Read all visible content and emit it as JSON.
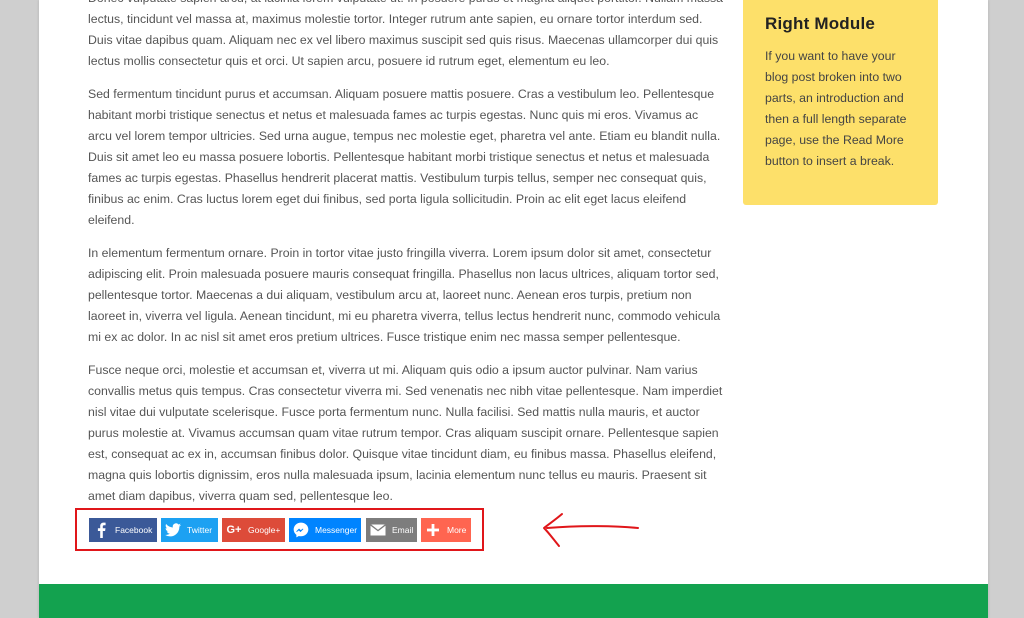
{
  "content": {
    "paragraphs": [
      "Donec vulputate sapien arcu, at lacinia lorem vulputate ut. In posuere purus et magna aliquet porttitor. Nullam massa lectus, tincidunt vel massa at, maximus molestie tortor. Integer rutrum ante sapien, eu ornare tortor interdum sed. Duis vitae dapibus quam. Aliquam nec ex vel libero maximus suscipit sed quis risus. Maecenas ullamcorper dui quis lectus mollis consectetur quis et orci. Ut sapien arcu, posuere id rutrum eget, elementum eu leo.",
      "Sed fermentum tincidunt purus et accumsan. Aliquam posuere mattis posuere. Cras a vestibulum leo. Pellentesque habitant morbi tristique senectus et netus et malesuada fames ac turpis egestas. Nunc quis mi eros. Vivamus ac arcu vel lorem tempor ultricies. Sed urna augue, tempus nec molestie eget, pharetra vel ante. Etiam eu blandit nulla. Duis sit amet leo eu massa posuere lobortis. Pellentesque habitant morbi tristique senectus et netus et malesuada fames ac turpis egestas. Phasellus hendrerit placerat mattis. Vestibulum turpis tellus, semper nec consequat quis, finibus ac enim. Cras luctus lorem eget dui finibus, sed porta ligula sollicitudin. Proin ac elit eget lacus eleifend eleifend.",
      "In elementum fermentum ornare. Proin in tortor vitae justo fringilla viverra. Lorem ipsum dolor sit amet, consectetur adipiscing elit. Proin malesuada posuere mauris consequat fringilla. Phasellus non lacus ultrices, aliquam tortor sed, pellentesque tortor. Maecenas a dui aliquam, vestibulum arcu at, laoreet nunc. Aenean eros turpis, pretium non laoreet in, viverra vel ligula. Aenean tincidunt, mi eu pharetra viverra, tellus lectus hendrerit nunc, commodo vehicula mi ex ac dolor. In ac nisl sit amet eros pretium ultrices. Fusce tristique enim nec massa semper pellentesque.",
      "Fusce neque orci, molestie et accumsan et, viverra ut mi. Aliquam quis odio a ipsum auctor pulvinar. Nam varius convallis metus quis tempus. Cras consectetur viverra mi. Sed venenatis nec nibh vitae pellentesque. Nam imperdiet nisl vitae dui vulputate scelerisque. Fusce porta fermentum nunc. Nulla facilisi. Sed mattis nulla mauris, et auctor purus molestie at. Vivamus accumsan quam vitae rutrum tempor. Cras aliquam suscipit ornare. Pellentesque sapien est, consequat ac ex in, accumsan finibus dolor. Quisque vitae tincidunt diam, eu finibus massa. Phasellus eleifend, magna quis lobortis dignissim, eros nulla malesuada ipsum, lacinia elementum nunc tellus eu mauris. Praesent sit amet diam dapibus, viverra quam sed, pellentesque leo."
    ]
  },
  "right_module": {
    "title": "Right Module",
    "text": "If you want to have your blog post broken into two parts, an introduction and then a full length separate page, use the Read More button to insert a break.",
    "background": "#fde06a"
  },
  "share": {
    "buttons": [
      {
        "label": "Facebook",
        "icon": "facebook-icon",
        "color": "#3b5998"
      },
      {
        "label": "Twitter",
        "icon": "twitter-icon",
        "color": "#1da1f2"
      },
      {
        "label": "Google+",
        "icon": "google-plus-icon",
        "color": "#dd4b39"
      },
      {
        "label": "Messenger",
        "icon": "messenger-icon",
        "color": "#0084ff"
      },
      {
        "label": "Email",
        "icon": "email-icon",
        "color": "#7d7d7d"
      },
      {
        "label": "More",
        "icon": "plus-icon",
        "color": "#ff6550"
      }
    ],
    "highlight_color": "#e0161a"
  },
  "footer": {
    "color": "#13a24f"
  },
  "page_background": "#cfcfcf"
}
